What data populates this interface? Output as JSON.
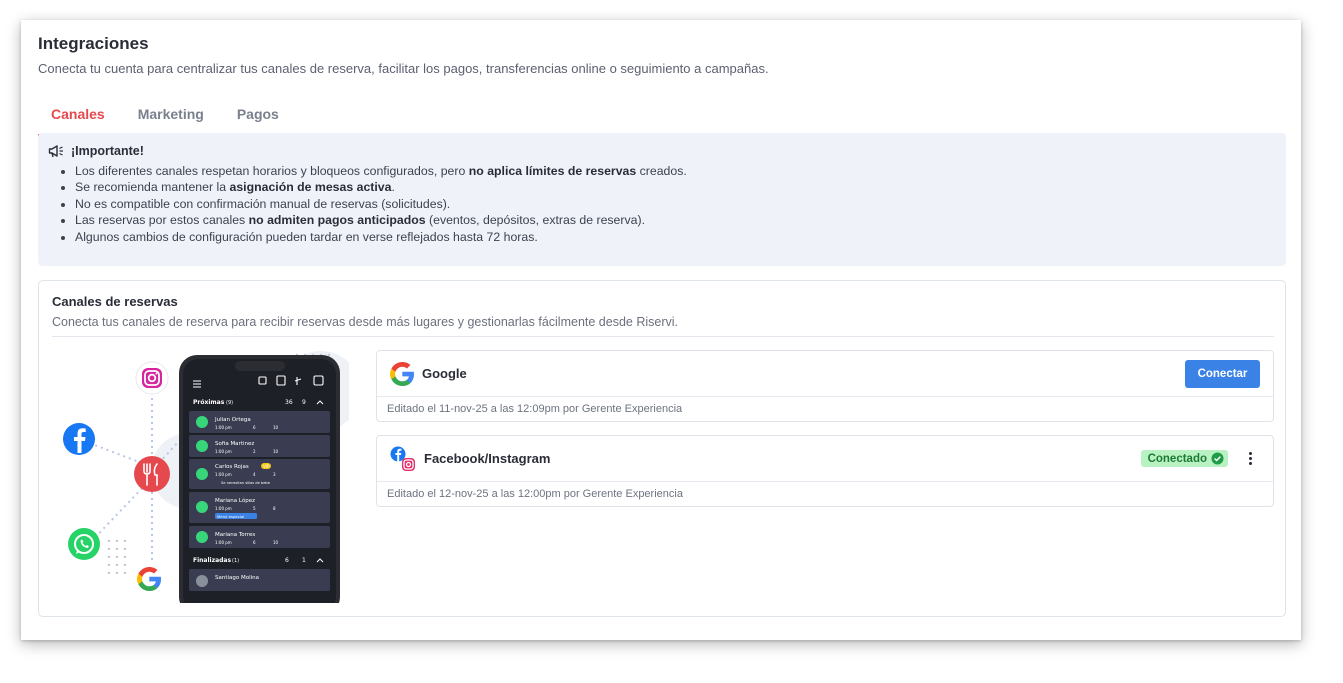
{
  "header": {
    "title": "Integraciones",
    "subtitle": "Conecta tu cuenta para centralizar tus canales de reserva, facilitar los pagos, transferencias online o seguimiento a campañas."
  },
  "tabs": [
    {
      "label": "Canales",
      "active": true
    },
    {
      "label": "Marketing",
      "active": false
    },
    {
      "label": "Pagos",
      "active": false
    }
  ],
  "notice": {
    "title": "¡Importante!",
    "items": [
      {
        "before": "Los diferentes canales respetan horarios y bloqueos configurados, pero ",
        "bold": "no aplica límites de reservas",
        "after": " creados."
      },
      {
        "before": "Se recomienda mantener la ",
        "bold": "asignación de mesas activa",
        "after": "."
      },
      {
        "before": "No es compatible con confirmación manual de reservas (solicitudes).",
        "bold": "",
        "after": ""
      },
      {
        "before": "Las reservas por estos canales ",
        "bold": "no admiten pagos anticipados",
        "after": " (eventos, depósitos, extras de reserva)."
      },
      {
        "before": "Algunos cambios de configuración pueden tardar en verse reflejados hasta 72 horas.",
        "bold": "",
        "after": ""
      }
    ]
  },
  "channels_panel": {
    "title": "Canales de reservas",
    "subtitle": "Conecta tus canales de reserva para recibir reservas desde más lugares y gestionarlas fácilmente desde Riservi.",
    "channels": [
      {
        "name": "Google",
        "edited": "Editado el 11-nov-25 a las 12:09pm por Gerente Experiencia",
        "action_label": "Conectar",
        "icon": "google-icon"
      },
      {
        "name": "Facebook/Instagram",
        "edited": "Editado el 12-nov-25 a las 12:00pm por Gerente Experiencia",
        "status_label": "Conectado",
        "icon": "facebook-instagram-icon"
      }
    ]
  },
  "phone": {
    "section_upcoming": "Próximas",
    "upcoming_count": "(9)",
    "upcoming_people": "36",
    "upcoming_tables": "9",
    "section_done": "Finalizadas",
    "done_count": "(1)",
    "done_people": "6",
    "done_tables": "1",
    "rows": [
      {
        "name": "Julian Ortega",
        "time": "1:00 pm",
        "people": "6",
        "table": "10"
      },
      {
        "name": "Sofia Martinez",
        "time": "1:00 pm",
        "people": "2",
        "table": "10"
      },
      {
        "name": "Carlos Rojas",
        "time": "1:00 pm",
        "people": "4",
        "table": "3",
        "vip": "VIP",
        "note": "Se necesitan sillas de bebe"
      },
      {
        "name": "Mariana López",
        "time": "1:00 pm",
        "people": "5",
        "table": "8",
        "tag": "Menú especial"
      },
      {
        "name": "Mariana Torres",
        "time": "1:00 pm",
        "people": "6",
        "table": "10"
      },
      {
        "name": "Santiago Molina"
      }
    ]
  },
  "colors": {
    "accent": "#e5484d",
    "primary_button": "#3b82e6",
    "connected_badge": "#b9f2c2",
    "notice_bg": "#eff3f9"
  }
}
